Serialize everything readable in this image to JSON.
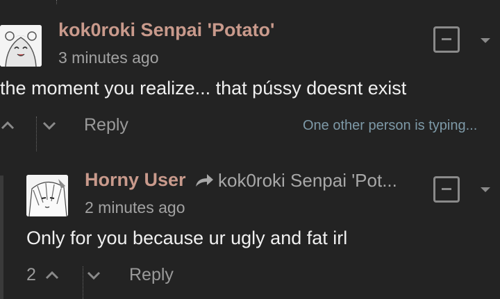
{
  "comments": [
    {
      "author": "kok0roki Senpai 'Potato'",
      "time": "3 minutes ago",
      "body": "the moment you realize... that pússy doesnt exist",
      "reply_label": "Reply",
      "typing_indicator": "One other person is typing..."
    },
    {
      "author": "Horny User",
      "in_reply_to": "kok0roki Senpai 'Pot...",
      "time": "2 minutes ago",
      "body": "Only for you because ur ugly and fat irl",
      "upvotes": "2",
      "reply_label": "Reply"
    }
  ],
  "colors": {
    "background": "#232323",
    "author": "#c99a8c",
    "typing": "#7e9aa8"
  },
  "icons": {
    "upvote": "chevron-up-icon",
    "downvote": "chevron-down-icon",
    "reply_arrow": "share-arrow-icon",
    "collapse": "minus-box-icon",
    "menu": "caret-down-icon"
  }
}
